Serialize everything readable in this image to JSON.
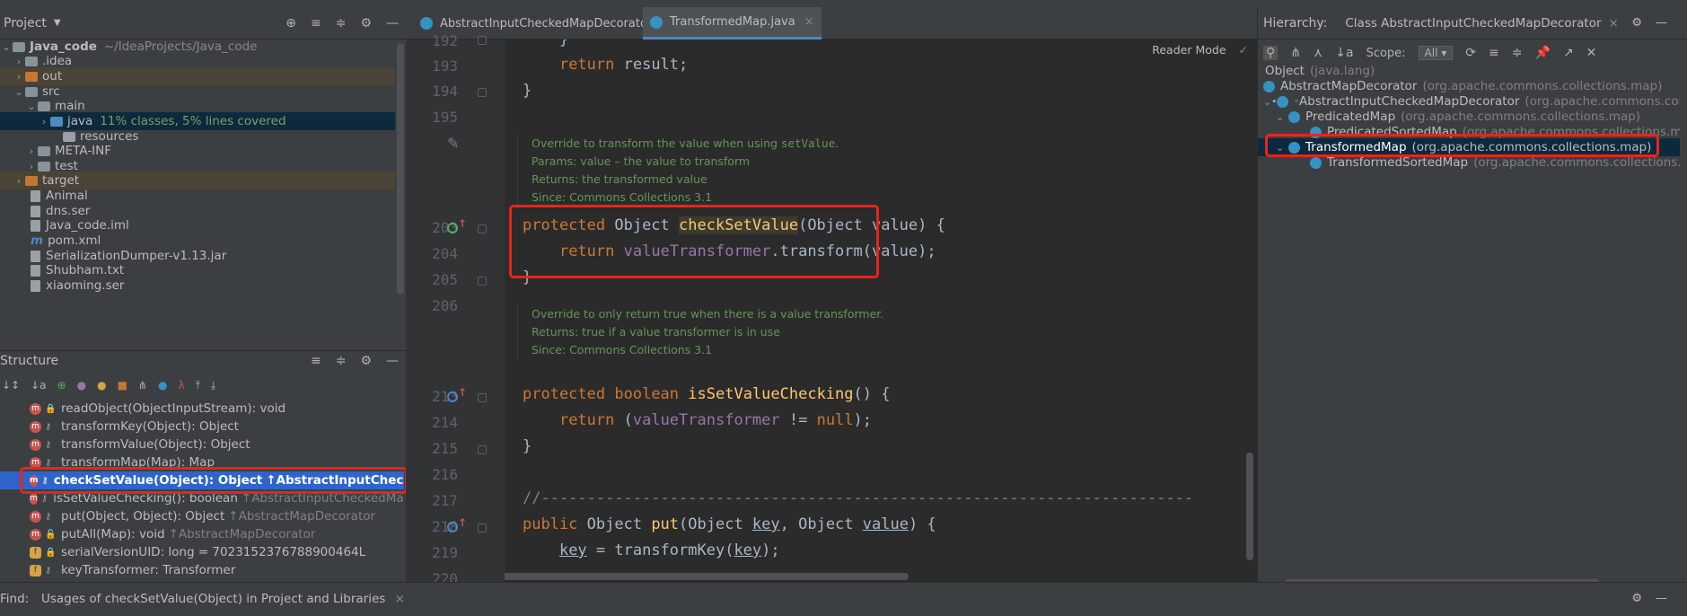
{
  "project_panel": {
    "title": "Project",
    "tree": [
      {
        "label": "Java_code",
        "extra": "~/IdeaProjects/Java_code",
        "kind": "module"
      },
      {
        "label": ".idea",
        "kind": "folder"
      },
      {
        "label": "out",
        "kind": "excluded"
      },
      {
        "label": "src",
        "kind": "folder"
      },
      {
        "label": "main",
        "kind": "folder"
      },
      {
        "label": "java",
        "extra": "11% classes, 5% lines covered",
        "kind": "source"
      },
      {
        "label": "resources",
        "kind": "resources"
      },
      {
        "label": "META-INF",
        "kind": "folder"
      },
      {
        "label": "test",
        "kind": "folder"
      },
      {
        "label": "target",
        "kind": "excluded"
      },
      {
        "label": "Animal",
        "kind": "file"
      },
      {
        "label": "dns.ser",
        "kind": "file"
      },
      {
        "label": "Java_code.iml",
        "kind": "file"
      },
      {
        "label": "pom.xml",
        "kind": "maven"
      },
      {
        "label": "SerializationDumper-v1.13.jar",
        "kind": "file"
      },
      {
        "label": "Shubham.txt",
        "kind": "file"
      },
      {
        "label": "xiaoming.ser",
        "kind": "file"
      }
    ]
  },
  "structure_panel": {
    "title": "Structure",
    "items": [
      {
        "label": "readObject(ObjectInputStream): void",
        "inherited": "",
        "badge": "m"
      },
      {
        "label": "transformKey(Object): Object",
        "inherited": "",
        "badge": "m"
      },
      {
        "label": "transformValue(Object): Object",
        "inherited": "",
        "badge": "m"
      },
      {
        "label": "transformMap(Map): Map",
        "inherited": "",
        "badge": "m"
      },
      {
        "label": "checkSetValue(Object): Object",
        "inherited": "↑AbstractInputCheckedMapD",
        "badge": "m",
        "selected": true
      },
      {
        "label": "isSetValueChecking(): boolean",
        "inherited": "↑AbstractInputCheckedMapD",
        "badge": "m"
      },
      {
        "label": "put(Object, Object): Object",
        "inherited": "↑AbstractMapDecorator",
        "badge": "m"
      },
      {
        "label": "putAll(Map): void",
        "inherited": "↑AbstractMapDecorator",
        "badge": "m"
      },
      {
        "label": "serialVersionUID: long = 7023152376788900464L",
        "inherited": "",
        "badge": "f"
      },
      {
        "label": "keyTransformer: Transformer",
        "inherited": "",
        "badge": "f"
      }
    ]
  },
  "editor": {
    "tabs": [
      {
        "label": "AbstractInputCheckedMapDecorator.java",
        "active": false
      },
      {
        "label": "TransformedMap.java",
        "active": true
      }
    ],
    "reader_mode": "Reader Mode",
    "lines": [
      {
        "num": "192",
        "code": "    }"
      },
      {
        "num": "193",
        "code": "    return result;"
      },
      {
        "num": "194",
        "code": "}"
      },
      {
        "num": "195",
        "code": ""
      },
      {
        "num": "203",
        "code": "protected Object checkSetValue(Object value) {"
      },
      {
        "num": "204",
        "code": "    return valueTransformer.transform(value);"
      },
      {
        "num": "205",
        "code": "}"
      },
      {
        "num": "206",
        "code": ""
      },
      {
        "num": "213",
        "code": "protected boolean isSetValueChecking() {"
      },
      {
        "num": "214",
        "code": "    return (valueTransformer != null);"
      },
      {
        "num": "215",
        "code": "}"
      },
      {
        "num": "216",
        "code": ""
      },
      {
        "num": "217",
        "code": "//-----------------------------------------------------------------------"
      },
      {
        "num": "218",
        "code": "public Object put(Object key, Object value) {"
      },
      {
        "num": "219",
        "code": "    key = transformKey(key);"
      },
      {
        "num": "220",
        "code": ""
      }
    ],
    "doc1": {
      "line1_pre": "Override to transform the value when using ",
      "line1_code": "setValue",
      "line1_post": ".",
      "line2": "Params:  value – the value to transform",
      "line3": "Returns: the transformed value",
      "line4": "Since:     Commons Collections 3.1"
    },
    "doc2": {
      "line1": "Override to only return true when there is a value transformer.",
      "line2": "Returns: true if a value transformer is in use",
      "line3": "Since:     Commons Collections 3.1"
    }
  },
  "hierarchy_panel": {
    "title": "Hierarchy:",
    "tab": "Class AbstractInputCheckedMapDecorator",
    "scope_label": "Scope:",
    "scope_value": "All",
    "items": [
      {
        "name": "Object",
        "pkg": "(java.lang)",
        "depth": 0
      },
      {
        "name": "AbstractMapDecorator",
        "pkg": "(org.apache.commons.collections.map)",
        "depth": 0
      },
      {
        "name": "AbstractInputCheckedMapDecorator",
        "pkg": "(org.apache.commons.colle",
        "depth": 1
      },
      {
        "name": "PredicatedMap",
        "pkg": "(org.apache.commons.collections.map)",
        "depth": 2
      },
      {
        "name": "PredicatedSortedMap",
        "pkg": "(org.apache.commons.collections.map)",
        "depth": 3
      },
      {
        "name": "TransformedMap",
        "pkg": "(org.apache.commons.collections.map)",
        "depth": 2,
        "selected": true
      },
      {
        "name": "TransformedSortedMap",
        "pkg": "(org.apache.commons.collections.m",
        "depth": 3
      }
    ]
  },
  "find_bar": {
    "label": "Find:",
    "tab": "Usages of checkSetValue(Object) in Project and Libraries"
  },
  "colors": {
    "keyword": "#cc7832",
    "field": "#9876aa",
    "method": "#ffc66d",
    "doc": "#629755",
    "highlight_box": "#e8241c",
    "selection": "#2f65ca"
  }
}
